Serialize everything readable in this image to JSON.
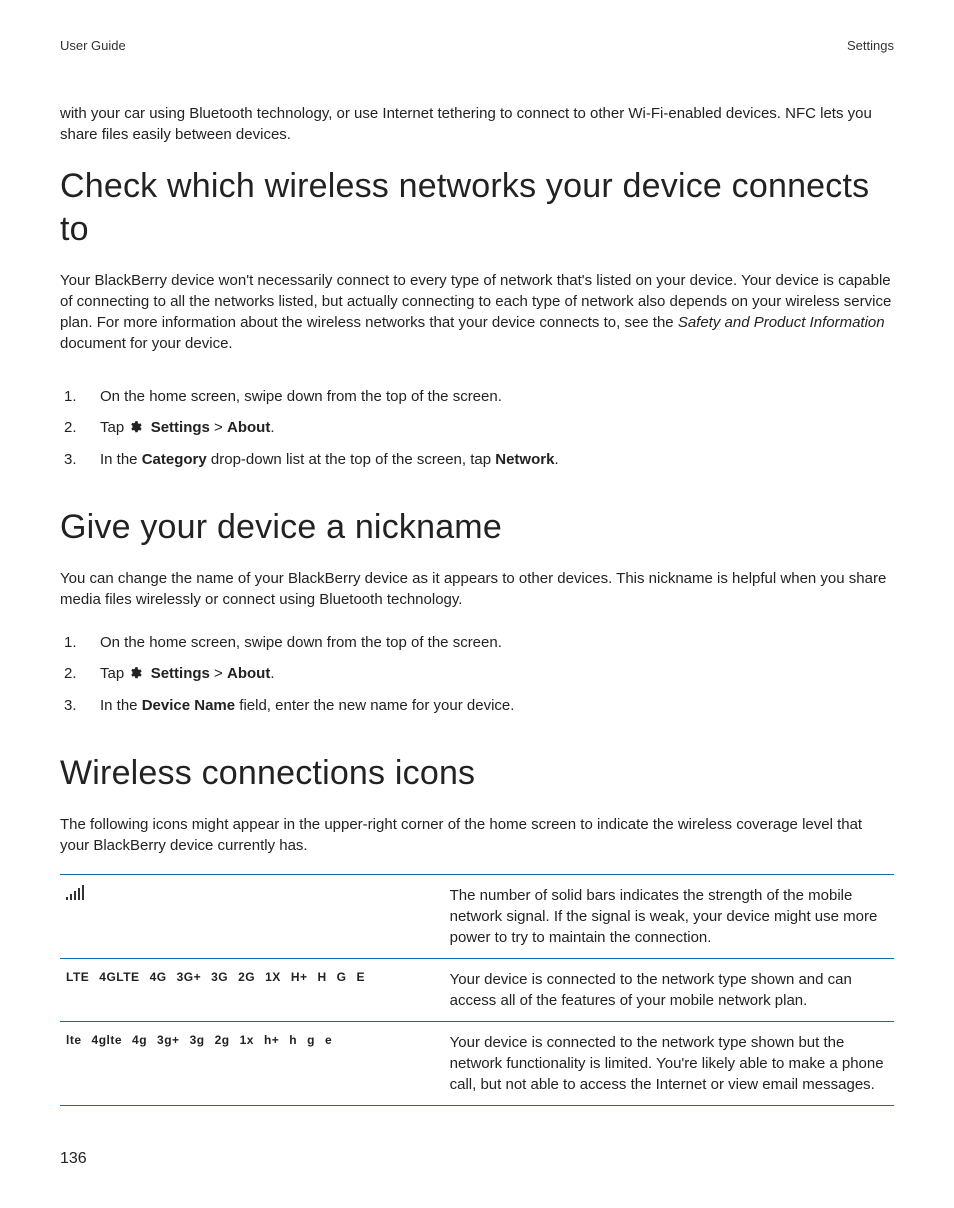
{
  "header": {
    "left": "User Guide",
    "right": "Settings"
  },
  "intro_top": "with your car using Bluetooth technology, or use Internet tethering to connect to other Wi-Fi-enabled devices. NFC lets you share files easily between devices.",
  "s1": {
    "title": "Check which wireless networks your device connects to",
    "para_pre": "Your BlackBerry device won't necessarily connect to every type of network that's listed on your device. Your device is capable of connecting to all the networks listed, but actually connecting to each type of network also depends on your wireless service plan. For more information about the wireless networks that your device connects to, see the ",
    "para_em": "Safety and Product Information",
    "para_post": " document for your device.",
    "step1": "On the home screen, swipe down from the top of the screen.",
    "step2_pre": "Tap ",
    "step2_settings": "Settings",
    "step2_sep": " > ",
    "step2_about": "About",
    "step2_end": ".",
    "step3_pre": "In the ",
    "step3_b1": "Category",
    "step3_mid": " drop-down list at the top of the screen, tap ",
    "step3_b2": "Network",
    "step3_end": "."
  },
  "s2": {
    "title": "Give your device a nickname",
    "para": "You can change the name of your BlackBerry device as it appears to other devices. This nickname is helpful when you share media files wirelessly or connect using Bluetooth technology.",
    "step1": "On the home screen, swipe down from the top of the screen.",
    "step2_pre": "Tap ",
    "step2_settings": "Settings",
    "step2_sep": " > ",
    "step2_about": "About",
    "step2_end": ".",
    "step3_pre": "In the ",
    "step3_b1": "Device Name",
    "step3_mid": " field, enter the new name for your device.",
    "step3_end": ""
  },
  "s3": {
    "title": "Wireless connections icons",
    "para": "The following icons might appear in the upper-right corner of the home screen to indicate the wireless coverage level that your BlackBerry device currently has.",
    "row1": {
      "desc": "The number of solid bars indicates the strength of the mobile network signal. If the signal is weak, your device might use more power to try to maintain the connection."
    },
    "row2": {
      "labels": [
        "LTE",
        "4GLTE",
        "4G",
        "3G+",
        "3G",
        "2G",
        "1X",
        "H+",
        "H",
        "G",
        "E"
      ],
      "desc": "Your device is connected to the network type shown and can access all of the features of your mobile network plan."
    },
    "row3": {
      "labels": [
        "lte",
        "4glte",
        "4g",
        "3g+",
        "3g",
        "2g",
        "1x",
        "h+",
        "h",
        "g",
        "e"
      ],
      "desc": "Your device is connected to the network type shown but the network functionality is limited. You're likely able to make a phone call, but not able to access the Internet or view email messages."
    }
  },
  "pageno": "136",
  "gear_icon_name": "gear-icon",
  "signal_icon_name": "signal-bars-icon"
}
